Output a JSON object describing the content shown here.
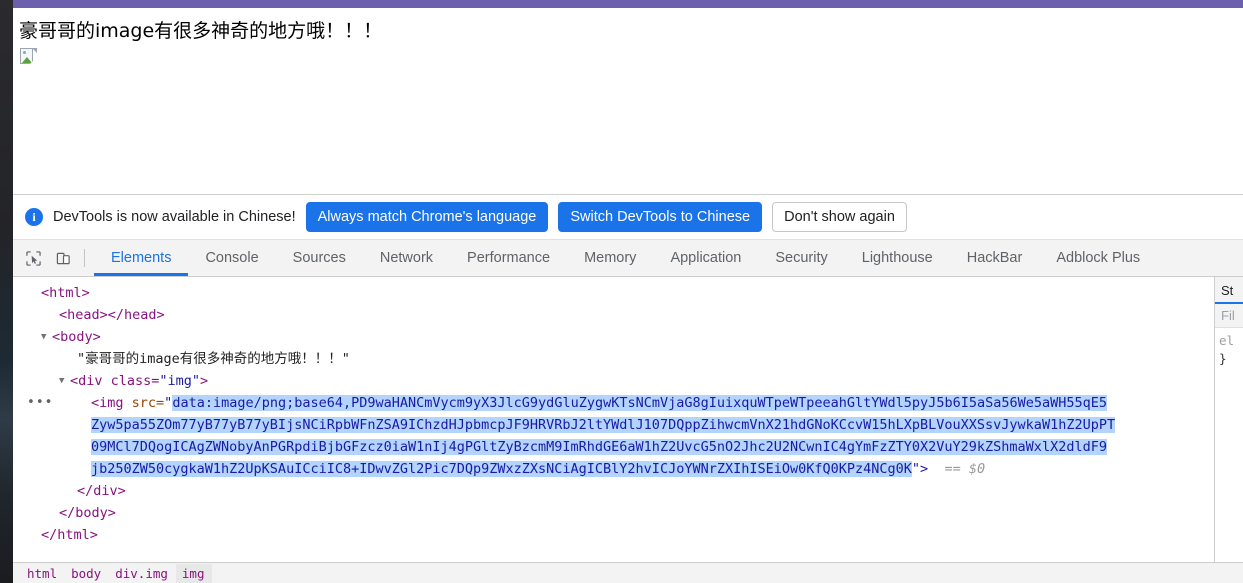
{
  "page": {
    "heading": "豪哥哥的image有很多神奇的地方哦！！！",
    "broken_image_alt": "broken-image"
  },
  "notice": {
    "message": "DevTools is now available in Chinese!",
    "primary_button": "Always match Chrome's language",
    "secondary_button": "Switch DevTools to Chinese",
    "dismiss_button": "Don't show again",
    "accent_color": "#1a73e8"
  },
  "devtools": {
    "tabs": [
      {
        "label": "Elements",
        "active": true
      },
      {
        "label": "Console",
        "active": false
      },
      {
        "label": "Sources",
        "active": false
      },
      {
        "label": "Network",
        "active": false
      },
      {
        "label": "Performance",
        "active": false
      },
      {
        "label": "Memory",
        "active": false
      },
      {
        "label": "Application",
        "active": false
      },
      {
        "label": "Security",
        "active": false
      },
      {
        "label": "Lighthouse",
        "active": false
      },
      {
        "label": "HackBar",
        "active": false
      },
      {
        "label": "Adblock Plus",
        "active": false
      }
    ],
    "inspect_icon": "cursor-inspect-icon",
    "device_icon": "device-toolbar-icon"
  },
  "dom": {
    "line_html_open": "<html>",
    "line_head": "<head></head>",
    "line_body_open": "<body>",
    "line_text_node": "\"豪哥哥的image有很多神奇的地方哦！！！\"",
    "line_div_open_a": "<div class=",
    "line_div_class": "\"img\"",
    "line_div_open_b": ">",
    "img_tag": "<img",
    "img_attr_name": "src=",
    "img_quote_open": "\"",
    "img_src_line1": "data:image/png;base64,PD9waHANCmVycm9yX3JlcG9ydGluZygwKTsNCmVjaG8gIuixquWTpeWTpeeahGltYWdl5pyJ5b6I5aSa56We5aWH55qE5",
    "img_src_line2": "Zyw5pa55ZOm77yB77yB77yBIjsNCiRpbWFnZSA9IChzdHJpbmcpJF9HRVRbJ2ltYWdlJ107DQppZihwcmVnX21hdGNoKCcvW15hLXpBLVouXXSsvJywkaW1hZ2UpPT",
    "img_src_line3": "09MCl7DQogICAgZWNobyAnPGRpdiBjbGFzcz0iaW1nIj4gPGltZyBzcmM9ImRhdGE6aW1hZ2UvcG5nO2Jhc2U2NCwnIC4gYmFzZTY0X2VuY29kZShmaWxlX2dldF9",
    "img_src_line4": "jb250ZW50cygkaW1hZ2UpKSAuICciIC8+IDwvZGl2Pic7DQp9ZWxzZXsNCiAgICBlY2hvICJoYWNrZXIhISEiOw0KfQ0KPz4NCg0K",
    "img_quote_close": "\">",
    "selected_marker": "== $0",
    "line_div_close": "</div>",
    "line_body_close": "</body>",
    "line_html_close": "</html>",
    "ellipsis": "•••"
  },
  "styles_panel": {
    "tab_label": "St",
    "filter_placeholder": "Fil",
    "rule_selector": "el",
    "rule_brace": "}"
  },
  "breadcrumb": {
    "items": [
      {
        "label": "html",
        "active": false
      },
      {
        "label": "body",
        "active": false
      },
      {
        "label": "div.img",
        "active": false
      },
      {
        "label": "img",
        "active": true
      }
    ]
  }
}
